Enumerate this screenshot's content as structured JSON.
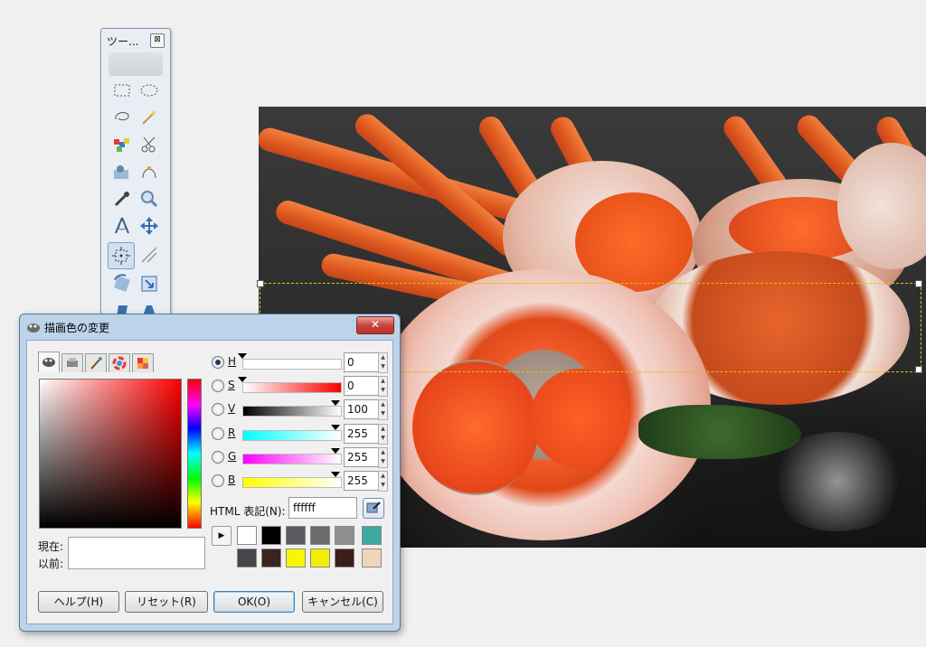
{
  "toolbox": {
    "title": "ツー...",
    "close_glyph": "⊠",
    "tools": [
      "rect-select-icon",
      "ellipse-select-icon",
      "free-select-icon",
      "fuzzy-select-icon",
      "color-select-icon",
      "scissors-select-icon",
      "foreground-select-icon",
      "paths-icon",
      "color-picker-icon",
      "zoom-icon",
      "measure-icon",
      "move-icon",
      "align-icon",
      "crop-icon",
      "rotate-icon",
      "scale-icon"
    ]
  },
  "dialog": {
    "title": "描画色の変更",
    "close_glyph": "✕",
    "selector_tabs": [
      "gimp-selector-icon",
      "cmyk-selector-icon",
      "watercolor-selector-icon",
      "wheel-selector-icon",
      "palette-selector-icon"
    ],
    "current_label": "現在:",
    "previous_label": "以前:",
    "channels": [
      {
        "label": "H",
        "value": "0",
        "selected": true
      },
      {
        "label": "S",
        "value": "0",
        "selected": false
      },
      {
        "label": "V",
        "value": "100",
        "selected": false
      },
      {
        "label": "R",
        "value": "255",
        "selected": false
      },
      {
        "label": "G",
        "value": "255",
        "selected": false
      },
      {
        "label": "B",
        "value": "255",
        "selected": false
      }
    ],
    "html_label": "HTML 表記(N):",
    "html_value": "ffffff",
    "history_colors": [
      "#ffffff",
      "#000000",
      "#5a5a5e",
      "#6c6c70",
      "#8e8e90",
      "#3fa9a0",
      "#44464c",
      "#3a2420",
      "#f7f700",
      "#f2f000",
      "#3a1e1a",
      "#eed6b8"
    ],
    "buttons": {
      "help": "ヘルプ(H)",
      "reset": "リセット(R)",
      "ok": "OK(O)",
      "cancel": "キャンセル(C)"
    },
    "current_color": "#ffffff"
  }
}
